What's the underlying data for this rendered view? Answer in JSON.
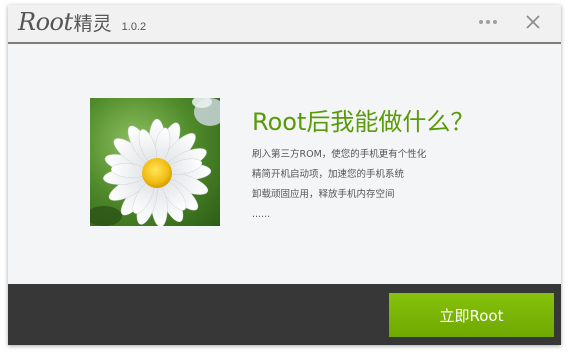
{
  "app": {
    "logo_en": "Root",
    "logo_cn": "精灵",
    "version": "1.0.2"
  },
  "titlebar": {
    "menu_icon": "more-dots-icon",
    "close_icon": "close-icon"
  },
  "main": {
    "image": "daisy-flower-photo",
    "heading": "Root后我能做什么？",
    "features": [
      "刷入第三方ROM，使您的手机更有个性化",
      "精简开机启动项，加速您的手机系统",
      "卸载顽固应用，释放手机内存空间",
      "......"
    ]
  },
  "footer": {
    "root_button_label": "立即Root"
  },
  "colors": {
    "accent_green": "#7ab800",
    "heading_green": "#5a9a0a",
    "footer_bg": "#373737",
    "content_bg": "#f4f5f6"
  }
}
